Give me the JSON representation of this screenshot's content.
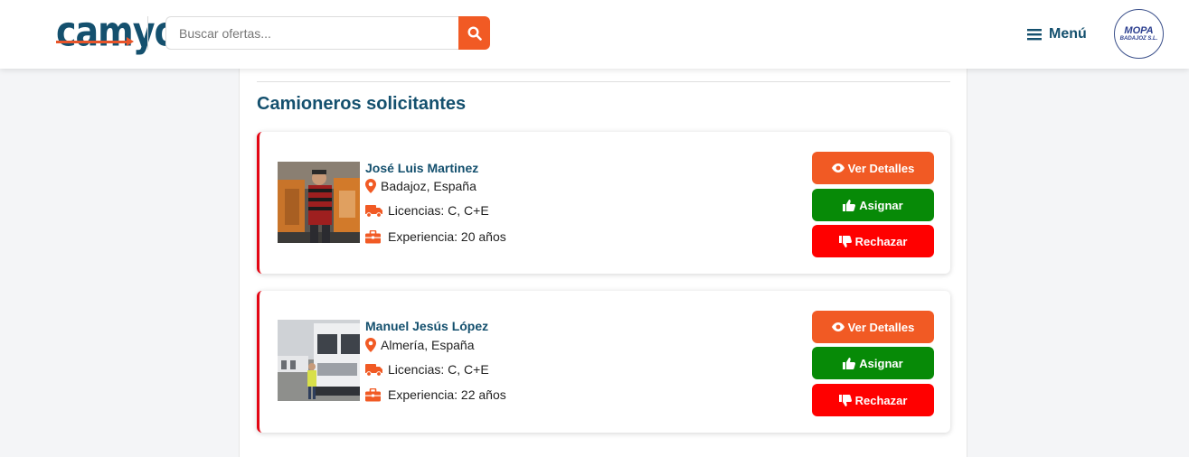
{
  "header": {
    "logo_text": "camyo",
    "search": {
      "placeholder": "Buscar ofertas...",
      "value": ""
    },
    "menu_label": "Menú",
    "company_logo": {
      "name": "MOPA",
      "subtitle": "BADAJOZ S.L."
    }
  },
  "main": {
    "title": "Camioneros solicitantes",
    "applicants": [
      {
        "name": "José Luis Martinez",
        "location": "Badajoz, España",
        "licenses": "Licencias: C, C+E",
        "experience": "Experiencia: 20 años"
      },
      {
        "name": "Manuel Jesús López",
        "location": "Almería, España",
        "licenses": "Licencias: C, C+E",
        "experience": "Experiencia: 22 años"
      }
    ],
    "actions": {
      "details_label": "Ver Detalles",
      "assign_label": "Asignar",
      "reject_label": "Rechazar"
    }
  },
  "colors": {
    "brand_blue": "#14506e",
    "accent_orange": "#f15a24",
    "assign_green": "#078a07",
    "reject_red": "#ff0000",
    "card_border_red": "#e30613"
  },
  "icons": [
    "search-icon",
    "hamburger-icon",
    "location-pin-icon",
    "truck-icon",
    "briefcase-icon",
    "eye-icon",
    "thumbs-up-icon",
    "thumbs-down-icon"
  ]
}
